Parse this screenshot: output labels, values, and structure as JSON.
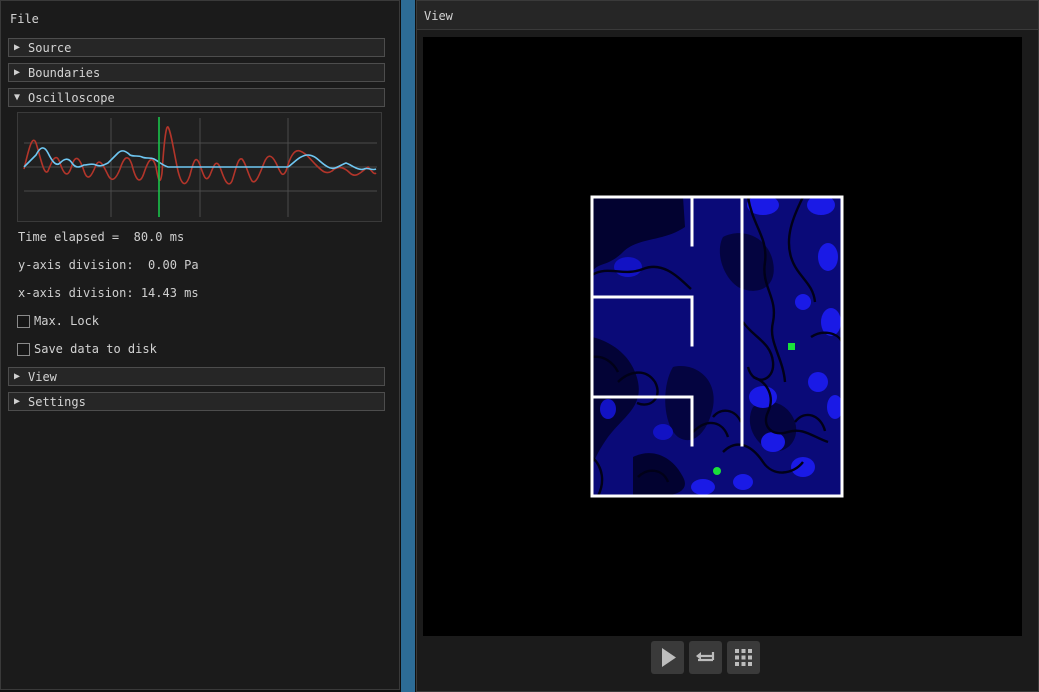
{
  "menu": {
    "file": "File"
  },
  "sections": {
    "source": "Source",
    "boundaries": "Boundaries",
    "oscilloscope": "Oscilloscope",
    "view": "View",
    "settings": "Settings"
  },
  "oscilloscope": {
    "time_elapsed": "Time elapsed =  80.0 ms",
    "y_division": "y-axis division:  0.00 Pa",
    "x_division": "x-axis division: 14.43 ms",
    "max_lock_label": "Max. Lock",
    "save_label": "Save data to disk",
    "max_lock_checked": false,
    "save_checked": false
  },
  "view_window": {
    "title": "View"
  },
  "toolbar": {
    "play_icon": "play-icon",
    "loop_icon": "loop-icon",
    "grid_icon": "grid-icon"
  },
  "colors": {
    "accent": "#2d6c96",
    "trace_red": "#b3352a",
    "trace_blue": "#6fc7f2",
    "cursor_green": "#19c44a",
    "wall": "#ffffff",
    "source": "#19e03a"
  }
}
